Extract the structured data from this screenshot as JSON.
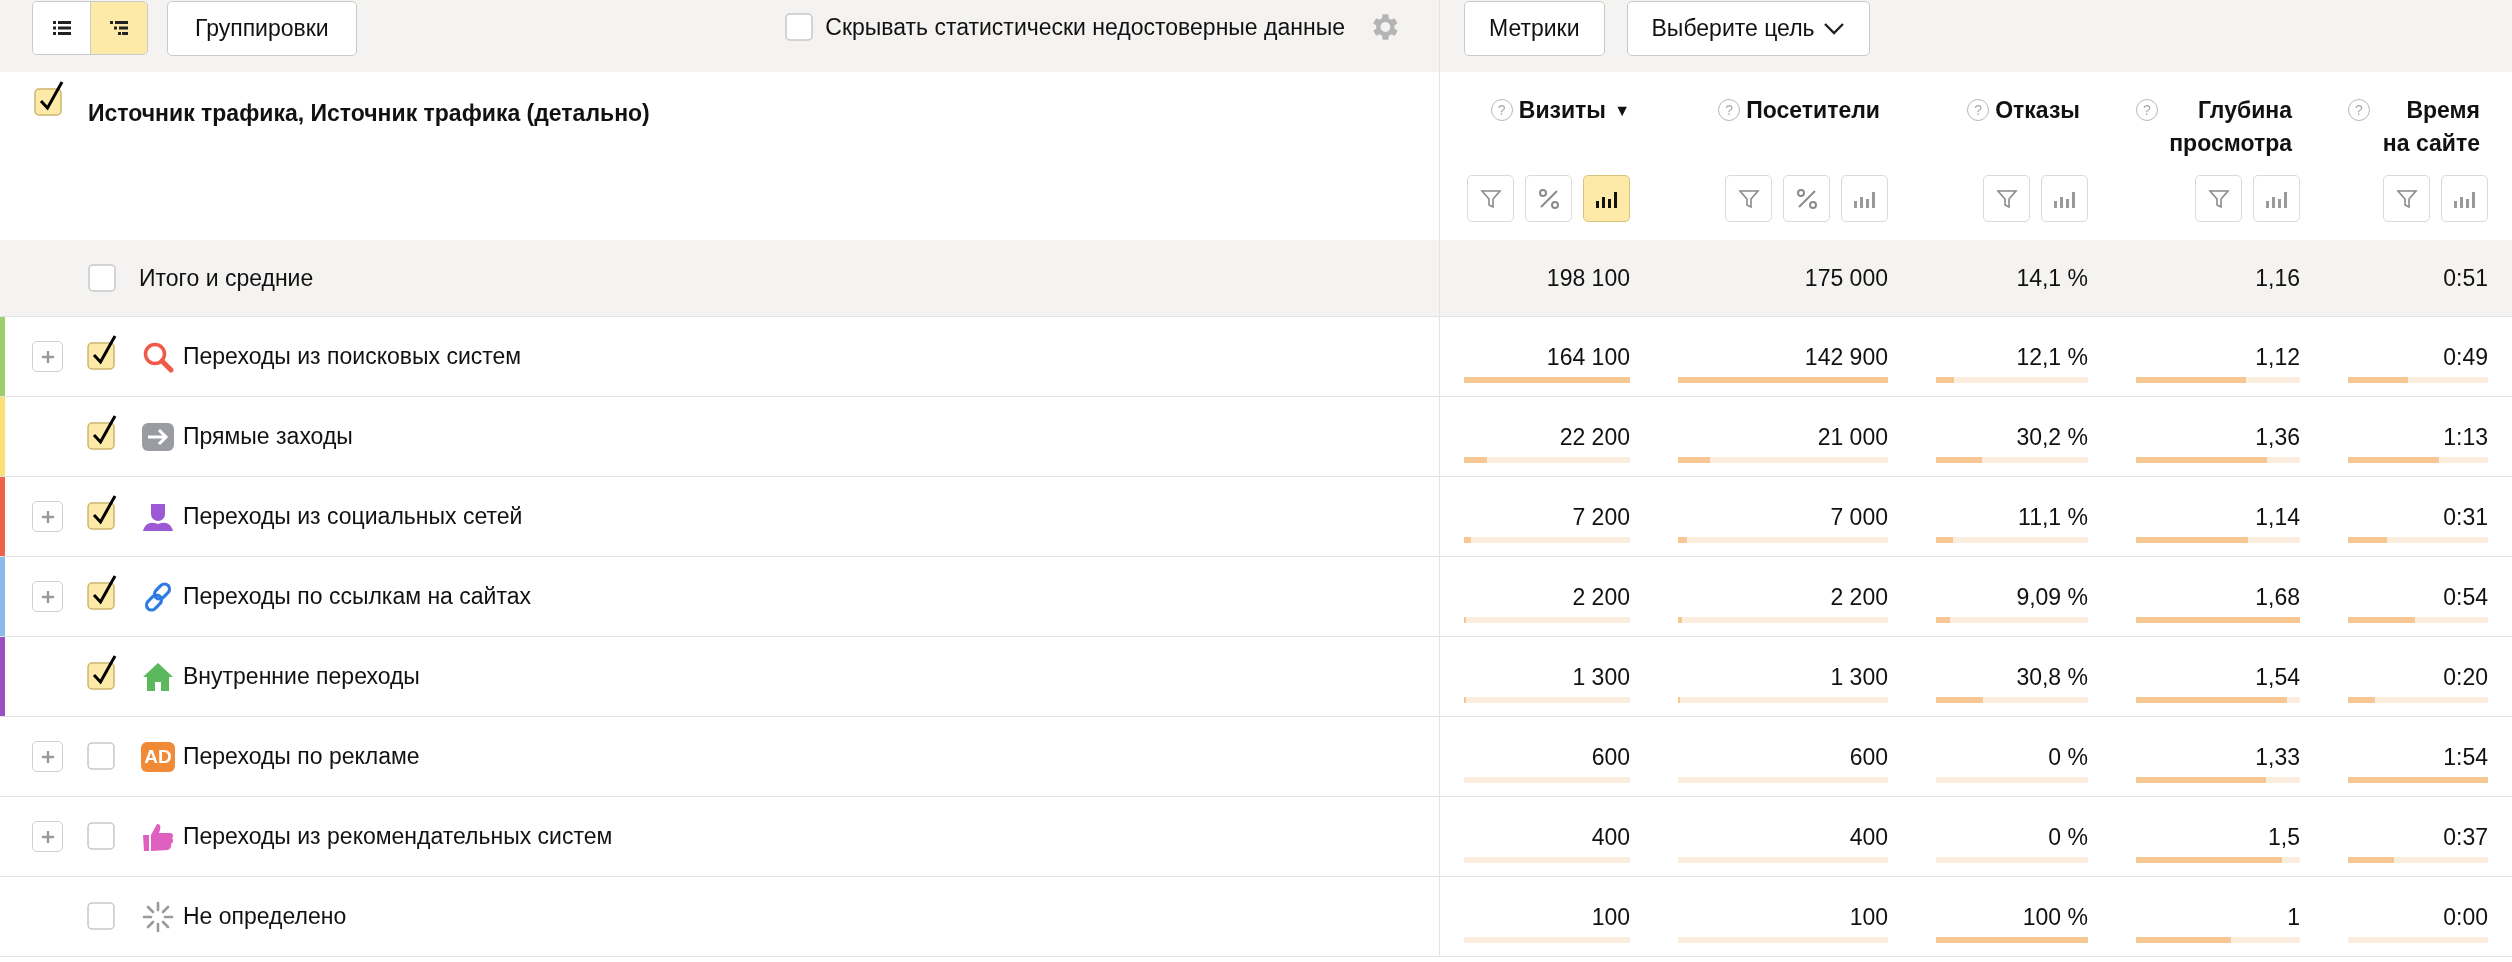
{
  "toolbar": {
    "view_buttons": [
      {
        "selected": false
      },
      {
        "selected": true
      }
    ],
    "groupings_button": "Группировки",
    "hide_unreliable": {
      "label": "Скрывать статистически недостоверные данные",
      "checked": false
    },
    "metrics_button": "Метрики",
    "goal_dropdown": "Выберите цель"
  },
  "table": {
    "dimension_header": {
      "title": "Источник трафика, Источник трафика (детально)",
      "checked": true
    },
    "columns": [
      {
        "title": "Визиты",
        "help_mark": "?",
        "sort_mark": "▼",
        "tools": [
          {
            "kind": "filter",
            "selected": false
          },
          {
            "kind": "percent",
            "selected": false
          },
          {
            "kind": "chart",
            "selected": true
          }
        ]
      },
      {
        "title": "Посетители",
        "help_mark": "?",
        "tools": [
          {
            "kind": "filter",
            "selected": false
          },
          {
            "kind": "percent",
            "selected": false
          },
          {
            "kind": "chart",
            "selected": false
          }
        ]
      },
      {
        "title": "Отказы",
        "help_mark": "?",
        "tools": [
          {
            "kind": "filter",
            "selected": false
          },
          {
            "kind": "chart",
            "selected": false
          }
        ]
      },
      {
        "title": "Глубина просмотра",
        "help_mark": "?",
        "tools": [
          {
            "kind": "filter",
            "selected": false
          },
          {
            "kind": "chart",
            "selected": false
          }
        ]
      },
      {
        "title": "Время на сайте",
        "help_mark": "?",
        "tools": [
          {
            "kind": "filter",
            "selected": false
          },
          {
            "kind": "chart",
            "selected": false
          }
        ]
      }
    ],
    "totals": {
      "label": "Итого и средние",
      "checked": false,
      "values": [
        "198 100",
        "175 000",
        "14,1 %",
        "1,16",
        "0:51"
      ]
    },
    "rows": [
      {
        "label": "Переходы из поисковых систем",
        "color": "#9ccf6a",
        "expandable": true,
        "checked": true,
        "cells": [
          {
            "value": "164 100",
            "level": 1
          },
          {
            "value": "142 900",
            "level": 1
          },
          {
            "value": "12,1 %",
            "level": 0.12
          },
          {
            "value": "1,12",
            "level": 0.67
          },
          {
            "value": "0:49",
            "level": 0.43
          }
        ]
      },
      {
        "label": "Прямые заходы",
        "color": "#fbe07a",
        "expandable": false,
        "checked": true,
        "cells": [
          {
            "value": "22 200",
            "level": 0.14
          },
          {
            "value": "21 000",
            "level": 0.15
          },
          {
            "value": "30,2 %",
            "level": 0.3
          },
          {
            "value": "1,36",
            "level": 0.8
          },
          {
            "value": "1:13",
            "level": 0.65
          }
        ]
      },
      {
        "label": "Переходы из социальных сетей",
        "color": "#f0614a",
        "expandable": true,
        "checked": true,
        "cells": [
          {
            "value": "7 200",
            "level": 0.04
          },
          {
            "value": "7 000",
            "level": 0.045
          },
          {
            "value": "11,1 %",
            "level": 0.11
          },
          {
            "value": "1,14",
            "level": 0.68
          },
          {
            "value": "0:31",
            "level": 0.28
          }
        ]
      },
      {
        "label": "Переходы по ссылкам на сайтах",
        "color": "#8abbe8",
        "expandable": true,
        "checked": true,
        "cells": [
          {
            "value": "2 200",
            "level": 0.015
          },
          {
            "value": "2 200",
            "level": 0.02
          },
          {
            "value": "9,09 %",
            "level": 0.09
          },
          {
            "value": "1,68",
            "level": 1
          },
          {
            "value": "0:54",
            "level": 0.48
          }
        ]
      },
      {
        "label": "Внутренние переходы",
        "color": "#9b4fc0",
        "expandable": false,
        "checked": true,
        "cells": [
          {
            "value": "1 300",
            "level": 0.01
          },
          {
            "value": "1 300",
            "level": 0.01
          },
          {
            "value": "30,8 %",
            "level": 0.31
          },
          {
            "value": "1,54",
            "level": 0.92
          },
          {
            "value": "0:20",
            "level": 0.19
          }
        ]
      },
      {
        "label": "Переходы по рекламе",
        "icon_text": "AD",
        "expandable": true,
        "checked": false,
        "cells": [
          {
            "value": "600",
            "level": 0
          },
          {
            "value": "600",
            "level": 0
          },
          {
            "value": "0 %",
            "level": 0
          },
          {
            "value": "1,33",
            "level": 0.79
          },
          {
            "value": "1:54",
            "level": 1
          }
        ]
      },
      {
        "label": "Переходы из рекомендательных систем",
        "expandable": true,
        "checked": false,
        "cells": [
          {
            "value": "400",
            "level": 0
          },
          {
            "value": "400",
            "level": 0
          },
          {
            "value": "0 %",
            "level": 0
          },
          {
            "value": "1,5",
            "level": 0.89
          },
          {
            "value": "0:37",
            "level": 0.33
          }
        ]
      },
      {
        "label": "Не определено",
        "expandable": false,
        "checked": false,
        "cells": [
          {
            "value": "100",
            "level": 0
          },
          {
            "value": "100",
            "level": 0
          },
          {
            "value": "100 %",
            "level": 1
          },
          {
            "value": "1",
            "level": 0.58
          },
          {
            "value": "0:00",
            "level": 0
          }
        ]
      }
    ]
  }
}
